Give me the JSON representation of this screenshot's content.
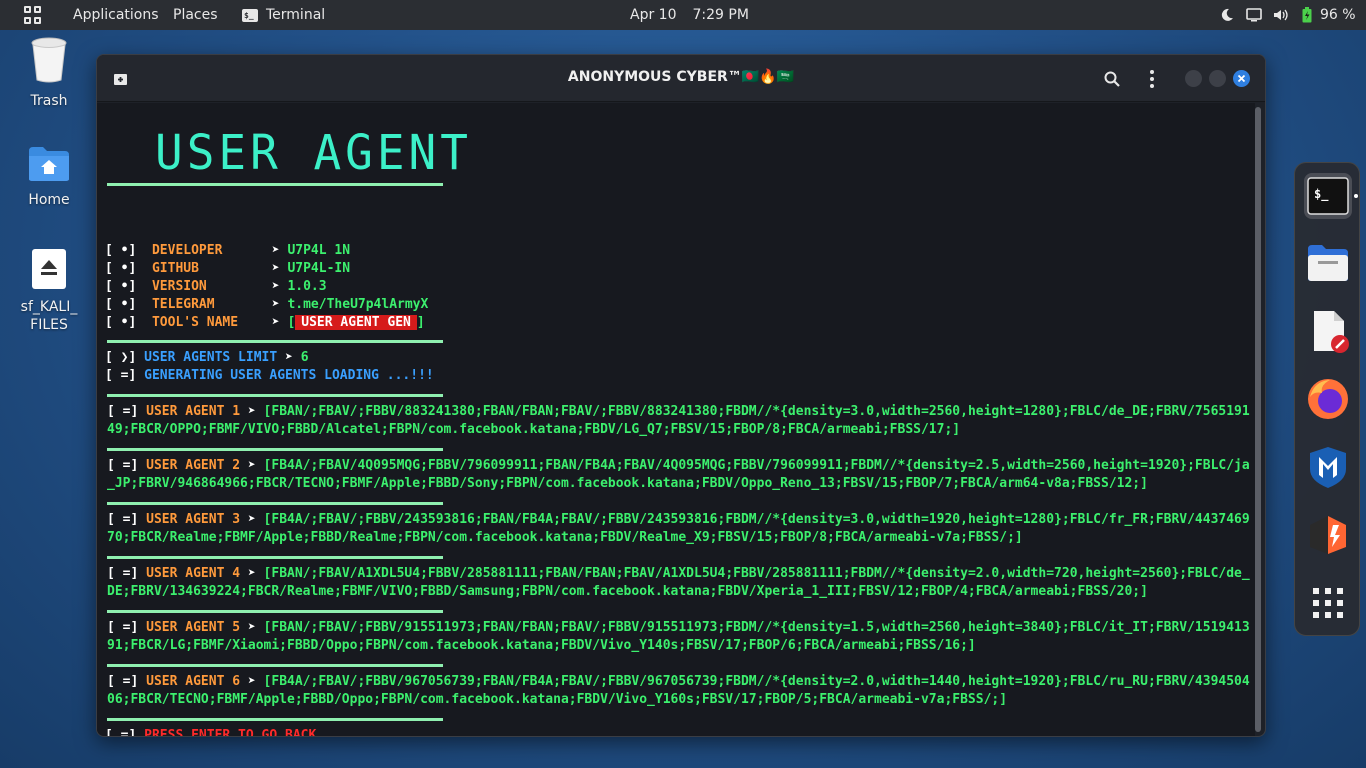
{
  "topbar": {
    "applications": "Applications",
    "places": "Places",
    "terminal": "Terminal",
    "date": "Apr 10",
    "time": "7:29 PM",
    "battery": "96 %"
  },
  "desktop": {
    "trash": "Trash",
    "home": "Home",
    "drive_line1": "sf_KALI_",
    "drive_line2": "FILES"
  },
  "window": {
    "title": "ANONYMOUS CYBER™🇧🇩🔥🇸🇦"
  },
  "terminal": {
    "banner": "USER AGENT",
    "info": [
      {
        "key": "DEVELOPER",
        "value": "U7P4L 1N"
      },
      {
        "key": "GITHUB",
        "value": "U7P4L-IN"
      },
      {
        "key": "VERSION",
        "value": "1.0.3"
      },
      {
        "key": "TELEGRAM",
        "value": "t.me/TheU7p4lArmyX"
      },
      {
        "key": "TOOL'S NAME",
        "value": "USER AGENT GEN"
      }
    ],
    "limit_label": "USER AGENTS LIMIT",
    "limit_value": "6",
    "loading": "GENERATING USER AGENTS LOADING ...!!!",
    "agents": [
      {
        "label": "USER AGENT 1",
        "value": "[FBAN/;FBAV/;FBBV/883241380;FBAN/FBAN;FBAV/;FBBV/883241380;FBDM//*{density=3.0,width=2560,height=1280};FBLC/de_DE;FBRV/756519149;FBCR/OPPO;FBMF/VIVO;FBBD/Alcatel;FBPN/com.facebook.katana;FBDV/LG_Q7;FBSV/15;FBOP/8;FBCA/armeabi;FBSS/17;]"
      },
      {
        "label": "USER AGENT 2",
        "value": "[FB4A/;FBAV/4Q095MQG;FBBV/796099911;FBAN/FB4A;FBAV/4Q095MQG;FBBV/796099911;FBDM//*{density=2.5,width=2560,height=1920};FBLC/ja_JP;FBRV/946864966;FBCR/TECNO;FBMF/Apple;FBBD/Sony;FBPN/com.facebook.katana;FBDV/Oppo_Reno_13;FBSV/15;FBOP/7;FBCA/arm64-v8a;FBSS/12;]"
      },
      {
        "label": "USER AGENT 3",
        "value": "[FB4A/;FBAV/;FBBV/243593816;FBAN/FB4A;FBAV/;FBBV/243593816;FBDM//*{density=3.0,width=1920,height=1280};FBLC/fr_FR;FBRV/443746970;FBCR/Realme;FBMF/Apple;FBBD/Realme;FBPN/com.facebook.katana;FBDV/Realme_X9;FBSV/15;FBOP/8;FBCA/armeabi-v7a;FBSS/;]"
      },
      {
        "label": "USER AGENT 4",
        "value": "[FBAN/;FBAV/A1XDL5U4;FBBV/285881111;FBAN/FBAN;FBAV/A1XDL5U4;FBBV/285881111;FBDM//*{density=2.0,width=720,height=2560};FBLC/de_DE;FBRV/134639224;FBCR/Realme;FBMF/VIVO;FBBD/Samsung;FBPN/com.facebook.katana;FBDV/Xperia_1_III;FBSV/12;FBOP/4;FBCA/armeabi;FBSS/20;]"
      },
      {
        "label": "USER AGENT 5",
        "value": "[FBAN/;FBAV/;FBBV/915511973;FBAN/FBAN;FBAV/;FBBV/915511973;FBDM//*{density=1.5,width=2560,height=3840};FBLC/it_IT;FBRV/151941391;FBCR/LG;FBMF/Xiaomi;FBBD/Oppo;FBPN/com.facebook.katana;FBDV/Vivo_Y140s;FBSV/17;FBOP/6;FBCA/armeabi;FBSS/16;]"
      },
      {
        "label": "USER AGENT 6",
        "value": "[FB4A/;FBAV/;FBBV/967056739;FBAN/FB4A;FBAV/;FBBV/967056739;FBDM//*{density=2.0,width=1440,height=1920};FBLC/ru_RU;FBRV/439450406;FBCR/TECNO;FBMF/Apple;FBBD/Oppo;FBPN/com.facebook.katana;FBDV/Vivo_Y160s;FBSV/17;FBOP/5;FBCA/armeabi-v7a;FBSS/;]"
      }
    ],
    "prompt": "PRESS ENTER TO GO BACK"
  },
  "colors": {
    "accent_green": "#3cf06e",
    "label_orange": "#ff9a3c",
    "label_blue": "#3aa0ff",
    "alert_red": "#ff2a2a"
  }
}
